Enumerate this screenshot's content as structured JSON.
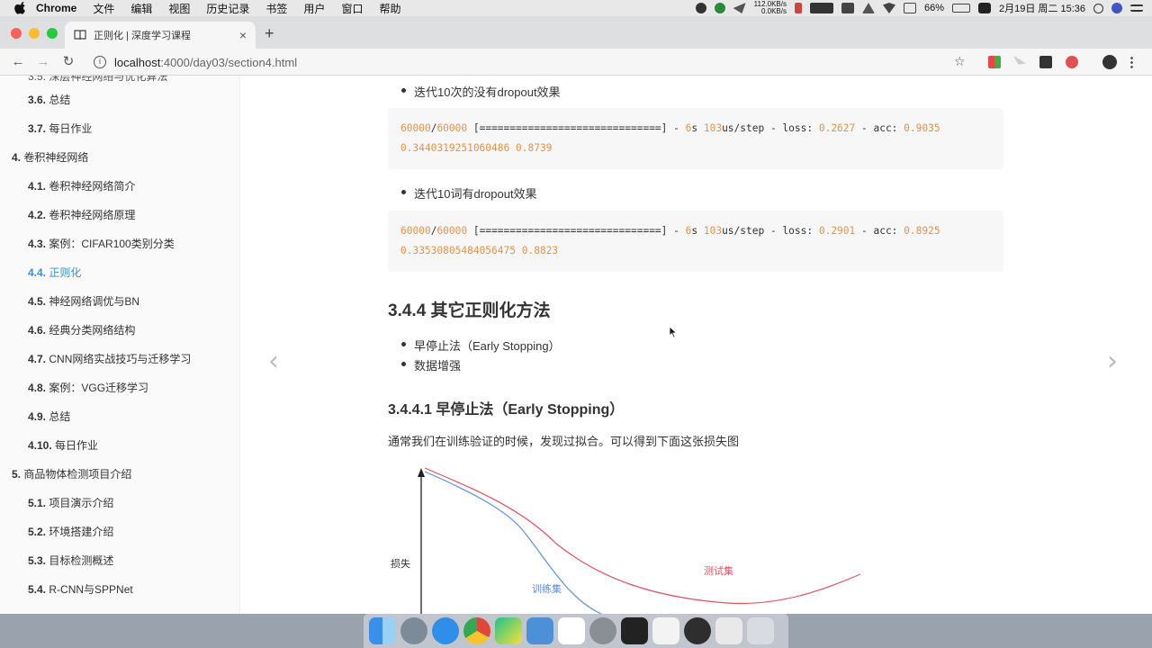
{
  "menubar": {
    "app": "Chrome",
    "items": [
      "文件",
      "编辑",
      "视图",
      "历史记录",
      "书签",
      "用户",
      "窗口",
      "帮助"
    ],
    "net_up": "112.0KB/s",
    "net_down": "0.0KB/s",
    "battery": "66%",
    "datetime": "2月19日 周二  15:36"
  },
  "browser": {
    "tab_title": "正则化 | 深度学习课程",
    "url_host": "localhost",
    "url_path": ":4000/day03/section4.html"
  },
  "sidebar": {
    "items": [
      {
        "num": "3.6.",
        "label": "总结"
      },
      {
        "num": "3.7.",
        "label": "每日作业"
      },
      {
        "num": "4.",
        "label": "卷积神经网络"
      },
      {
        "num": "4.1.",
        "label": "卷积神经网络简介"
      },
      {
        "num": "4.2.",
        "label": "卷积神经网络原理"
      },
      {
        "num": "4.3.",
        "label": "案例：CIFAR100类别分类"
      },
      {
        "num": "4.4.",
        "label": "正则化"
      },
      {
        "num": "4.5.",
        "label": "神经网络调优与BN"
      },
      {
        "num": "4.6.",
        "label": "经典分类网络结构"
      },
      {
        "num": "4.7.",
        "label": "CNN网络实战技巧与迁移学习"
      },
      {
        "num": "4.8.",
        "label": "案例：VGG迁移学习"
      },
      {
        "num": "4.9.",
        "label": "总结"
      },
      {
        "num": "4.10.",
        "label": "每日作业"
      },
      {
        "num": "5.",
        "label": "商品物体检测项目介绍"
      },
      {
        "num": "5.1.",
        "label": "项目演示介绍"
      },
      {
        "num": "5.2.",
        "label": "环境搭建介绍"
      },
      {
        "num": "5.3.",
        "label": "目标检测概述"
      },
      {
        "num": "5.4.",
        "label": "R-CNN与SPPNet"
      }
    ]
  },
  "content": {
    "bullet1": "迭代10次的没有dropout效果",
    "code1": {
      "a": "60000",
      "b": "60000",
      "bar": " [==============================] - ",
      "s": "6",
      "step": "103",
      "loss": "0.2627",
      "acc": "0.9035",
      "line2a": "0.3440319251060486",
      "line2b": "0.8739"
    },
    "bullet2": "迭代10词有dropout效果",
    "code2": {
      "a": "60000",
      "b": "60000",
      "bar": " [==============================] - ",
      "s": "6",
      "step": "103",
      "loss": "0.2901",
      "acc": "0.8925",
      "line2a": "0.33530805484056475",
      "line2b": "0.8823"
    },
    "code_tokens": {
      "s_unit": "s ",
      "step_unit": "us/step - loss: ",
      "acc_label": " - acc: "
    },
    "h3": "3.4.4 其它正则化方法",
    "list": [
      "早停止法（Early Stopping）",
      "数据增强"
    ],
    "h4": "3.4.4.1 早停止法（Early Stopping）",
    "para": "通常我们在训练验证的时候，发现过拟合。可以得到下面这张损失图",
    "figure": {
      "ylabel": "损失",
      "train_label": "训练集",
      "test_label": "测试集",
      "train_color": "#5b8de0",
      "test_color": "#e05060"
    }
  }
}
